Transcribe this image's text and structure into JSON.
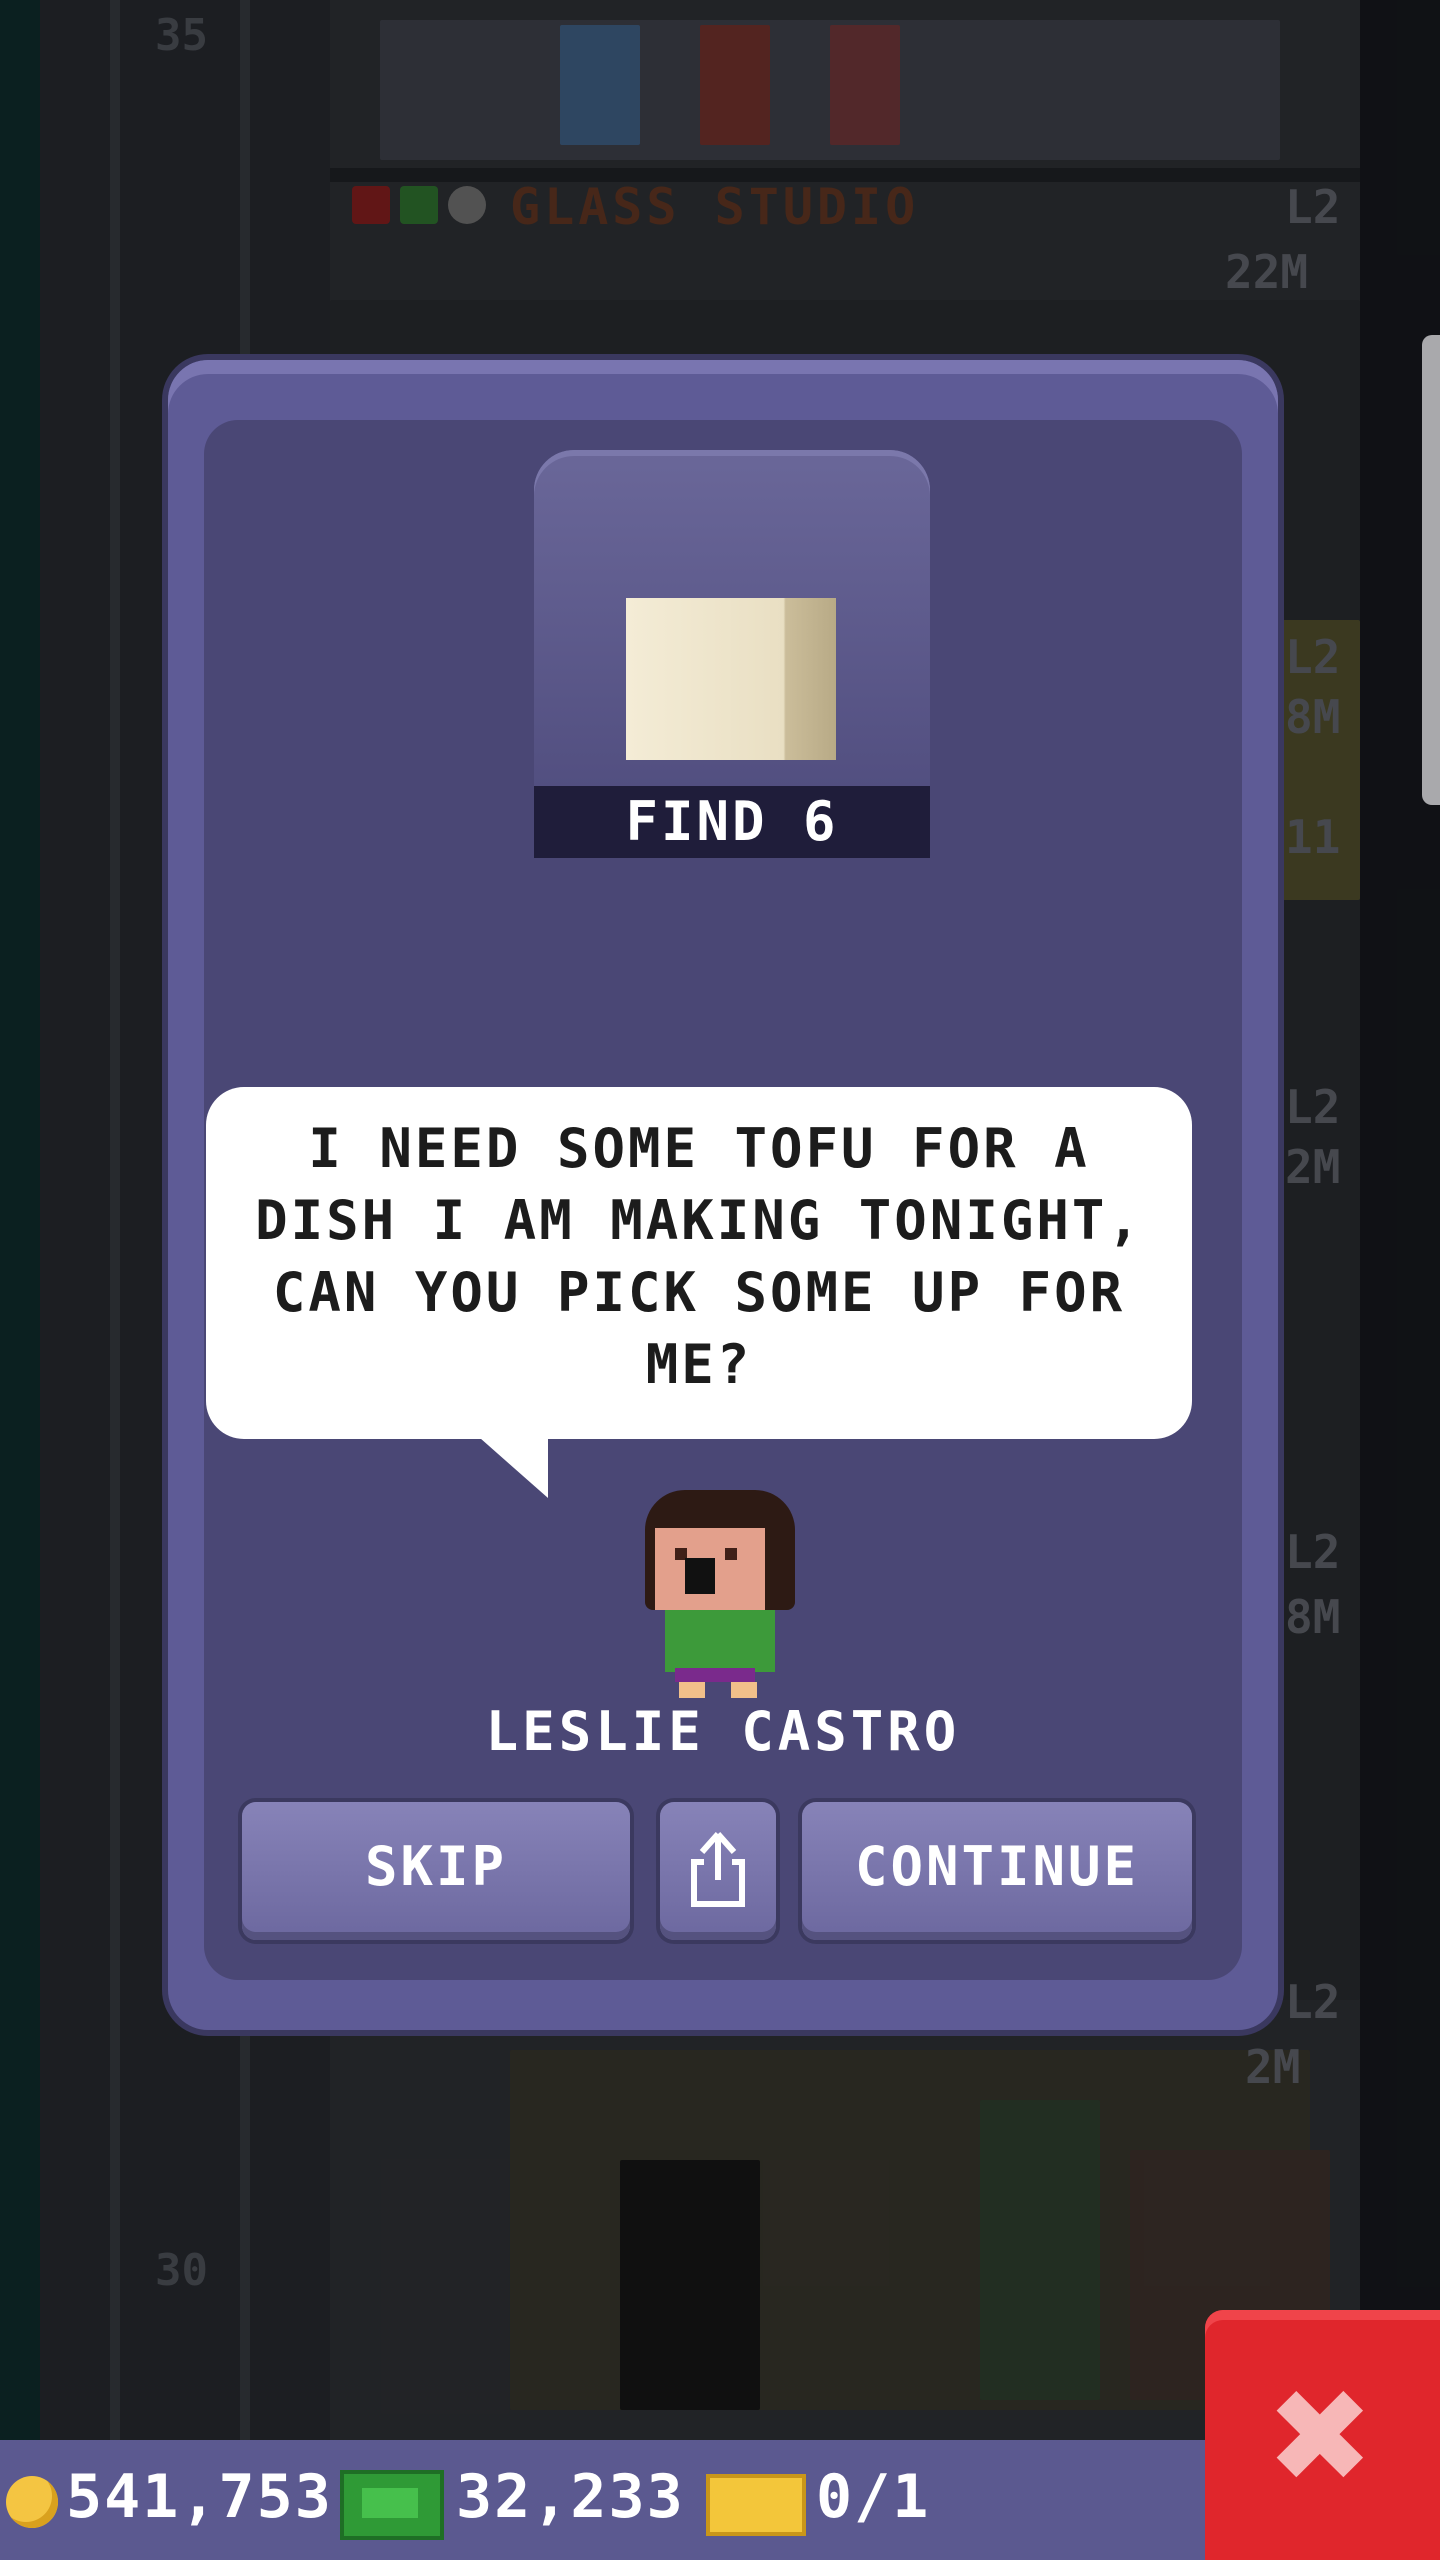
{
  "background": {
    "floor_numbers": [
      "35",
      "30"
    ],
    "floor_name": "GLASS STUDIO",
    "side_labels": [
      "L2",
      "22M",
      "L2",
      "8M",
      "L2",
      "2M",
      "L2",
      "8M",
      "L2",
      "2M",
      "11"
    ]
  },
  "dialog": {
    "item": {
      "icon": "tofu-icon",
      "label": "FIND 6"
    },
    "speech": "I NEED SOME TOFU FOR A DISH I AM MAKING TONIGHT, CAN YOU PICK SOME UP FOR ME?",
    "npc_name": "LESLIE CASTRO",
    "buttons": {
      "skip": "SKIP",
      "share_icon": "share-icon",
      "continue": "CONTINUE"
    }
  },
  "status_bar": {
    "coins": "541,753",
    "bux": "32,233",
    "tickets": "0/1"
  },
  "close_button": {
    "icon": "close-icon",
    "glyph": "✖"
  },
  "colors": {
    "dialog": "#5e5b96",
    "dialog_inner": "#4a4775",
    "button": "#7773ab",
    "close": "#e0262c"
  }
}
